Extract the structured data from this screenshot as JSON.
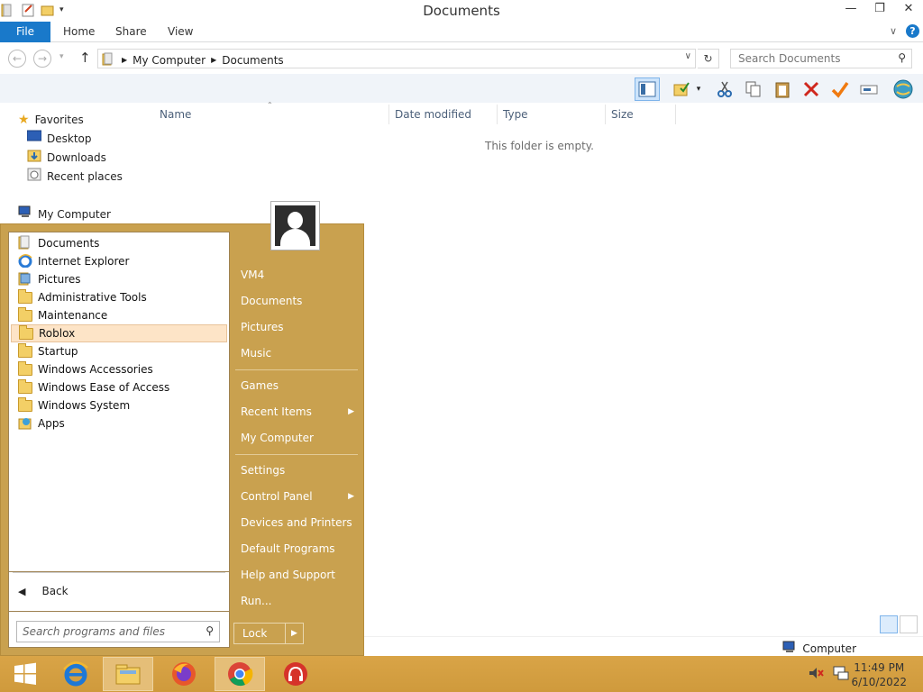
{
  "window": {
    "title": "Documents",
    "controls": {
      "minimize": "—",
      "restore": "❐",
      "close": "✕"
    }
  },
  "ribbon": {
    "tabs": [
      "File",
      "Home",
      "Share",
      "View"
    ],
    "help": "?"
  },
  "address": {
    "crumbs": [
      "My Computer",
      "Documents"
    ],
    "search_placeholder": "Search Documents"
  },
  "nav_pane": {
    "favorites_label": "Favorites",
    "favorites": [
      "Desktop",
      "Downloads",
      "Recent places"
    ],
    "computer_label": "My Computer"
  },
  "content": {
    "columns": [
      "Name",
      "Date modified",
      "Type",
      "Size"
    ],
    "empty_message": "This folder is empty."
  },
  "status": {
    "location": "Computer"
  },
  "start_menu": {
    "programs": [
      {
        "label": "Documents",
        "icon": "documents-folder-icon"
      },
      {
        "label": "Internet Explorer",
        "icon": "ie-icon"
      },
      {
        "label": "Pictures",
        "icon": "pictures-folder-icon"
      },
      {
        "label": "Administrative Tools",
        "icon": "folder-icon"
      },
      {
        "label": "Maintenance",
        "icon": "folder-icon"
      },
      {
        "label": "Roblox",
        "icon": "folder-icon",
        "selected": true
      },
      {
        "label": "Startup",
        "icon": "folder-icon"
      },
      {
        "label": "Windows Accessories",
        "icon": "folder-icon"
      },
      {
        "label": "Windows Ease of Access",
        "icon": "folder-icon"
      },
      {
        "label": "Windows System",
        "icon": "folder-icon"
      },
      {
        "label": "Apps",
        "icon": "apps-icon"
      }
    ],
    "back_label": "Back",
    "search_placeholder": "Search programs and files",
    "right_items": [
      {
        "label": "VM4"
      },
      {
        "label": "Documents"
      },
      {
        "label": "Pictures"
      },
      {
        "label": "Music"
      },
      {
        "label": "Games"
      },
      {
        "label": "Recent Items",
        "submenu": true
      },
      {
        "label": "My Computer"
      },
      {
        "label": "Settings"
      },
      {
        "label": "Control Panel",
        "submenu": true
      },
      {
        "label": "Devices and Printers"
      },
      {
        "label": "Default Programs"
      },
      {
        "label": "Help and Support"
      },
      {
        "label": "Run..."
      }
    ],
    "lock_label": "Lock",
    "accent": "#c9a14f"
  },
  "taskbar": {
    "apps": [
      "windows-start-icon",
      "ie-icon",
      "file-explorer-icon",
      "firefox-icon",
      "chrome-icon",
      "headphones-app-icon"
    ],
    "time": "11:49 PM",
    "date": "6/10/2022"
  }
}
